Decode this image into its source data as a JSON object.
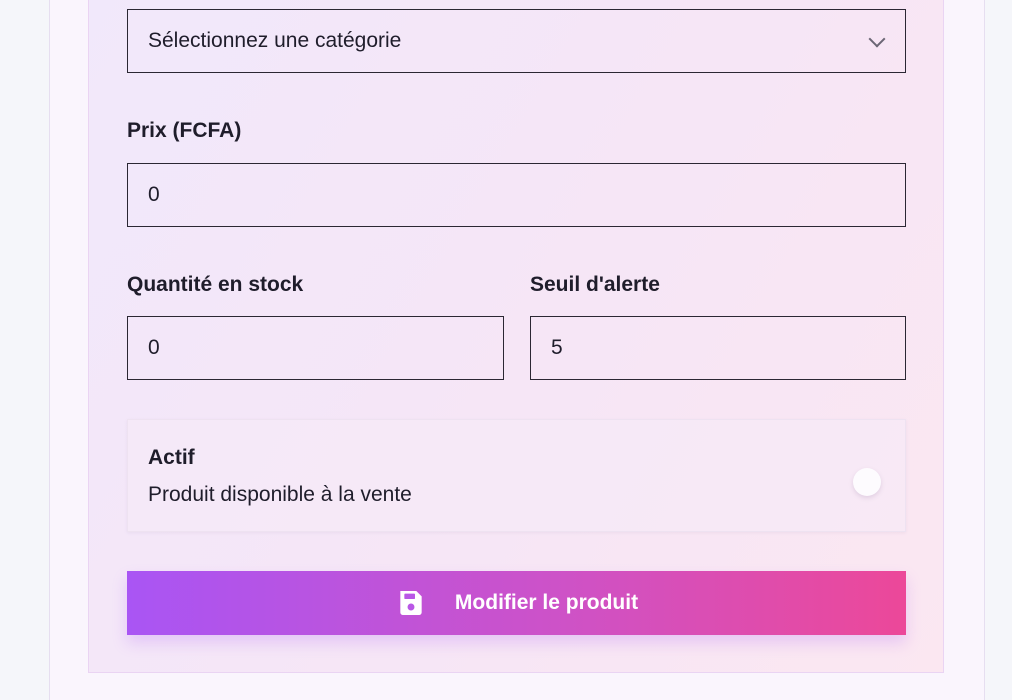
{
  "form": {
    "category_select": {
      "selected": "Sélectionnez une catégorie"
    },
    "price": {
      "label": "Prix (FCFA)",
      "value": "0"
    },
    "stock_quantity": {
      "label": "Quantité en stock",
      "value": "0"
    },
    "alert_threshold": {
      "label": "Seuil d'alerte",
      "value": "5"
    },
    "active_toggle": {
      "title": "Actif",
      "description": "Produit disponible à la vente",
      "state": "off"
    },
    "submit": {
      "label": "Modifier le produit",
      "icon": "save-icon"
    }
  },
  "colors": {
    "button_gradient_start": "#a955f4",
    "button_gradient_end": "#ec4899",
    "panel_background": "#f3e8fa",
    "border": "#2b2733"
  }
}
